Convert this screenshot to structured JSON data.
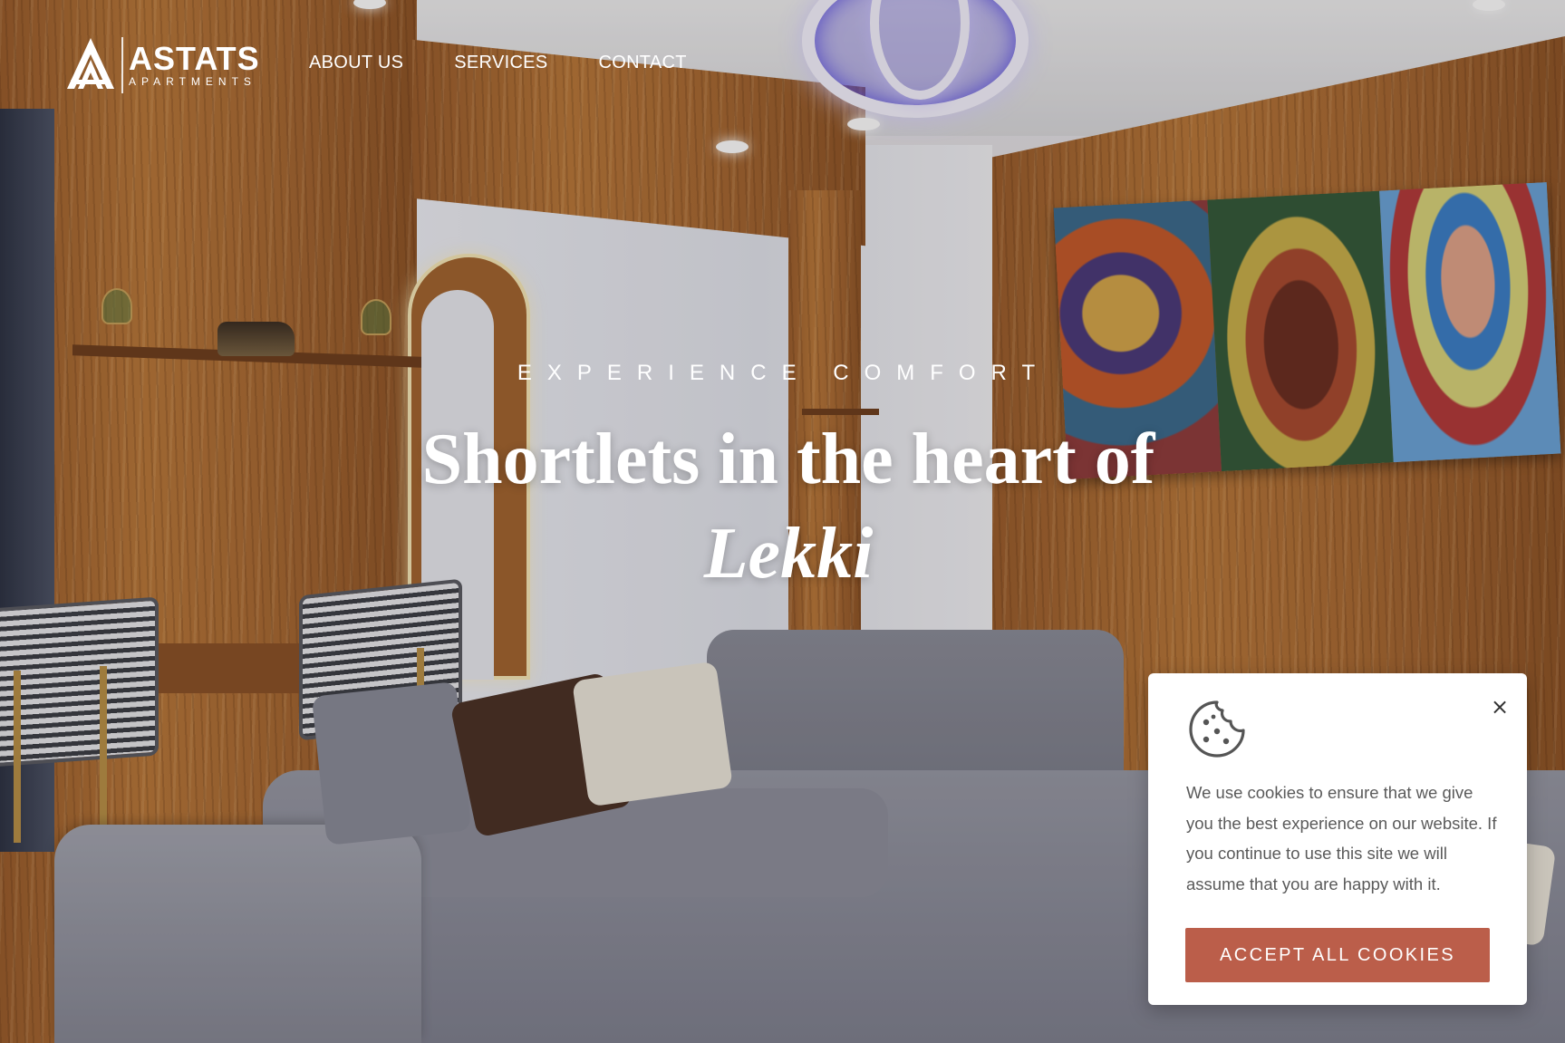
{
  "brand": {
    "name": "ASTATS",
    "subtitle": "APARTMENTS"
  },
  "nav": {
    "items": [
      {
        "label": "ABOUT US"
      },
      {
        "label": "SERVICES"
      },
      {
        "label": "CONTACT"
      }
    ]
  },
  "hero": {
    "eyebrow": "EXPERIENCE COMFORT",
    "headline_main": "Shortlets in the heart of ",
    "headline_emphasis": "Lekki"
  },
  "cookie_banner": {
    "message": "We use cookies to ensure that we give you the best experience on our website. If you continue to use this site we will assume that you are happy with it.",
    "accept_label": "ACCEPT ALL COOKIES",
    "close_symbol": "×",
    "icon": "cookie-icon"
  },
  "colors": {
    "accent": "#bb5e4a",
    "text_on_hero": "#ffffff",
    "card_text": "#5a5a5a"
  }
}
